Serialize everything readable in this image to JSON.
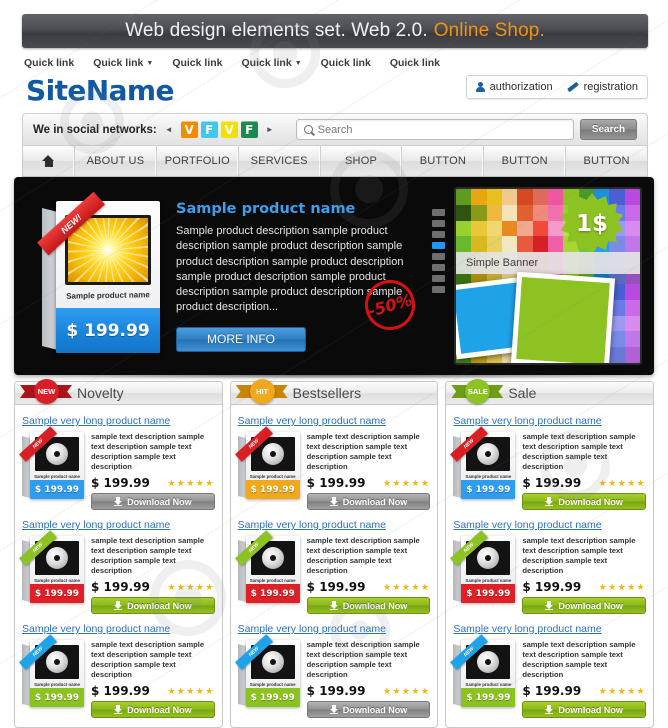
{
  "topbar": {
    "text_main": "Web design elements set. Web 2.0.",
    "text_accent": "Online Shop.",
    "accent_color": "#f2920d",
    "bg_color": "#4e4f55"
  },
  "quicklinks": [
    {
      "label": "Quick link",
      "has_dropdown": false
    },
    {
      "label": "Quick link",
      "has_dropdown": true
    },
    {
      "label": "Quick link",
      "has_dropdown": false
    },
    {
      "label": "Quick link",
      "has_dropdown": true
    },
    {
      "label": "Quick link",
      "has_dropdown": false
    },
    {
      "label": "Quick link",
      "has_dropdown": false
    }
  ],
  "brand": {
    "logo": "SiteName",
    "logo_color": "#1259a5"
  },
  "account": {
    "authorization": "authorization",
    "registration": "registration"
  },
  "social": {
    "label": "We in social networks:",
    "prev_arrow": "◄",
    "next_arrow": "►",
    "icons": [
      {
        "glyph": "V",
        "color": "#f28b00"
      },
      {
        "glyph": "F",
        "color": "#3fc8ee"
      },
      {
        "glyph": "V",
        "color": "#f2e000"
      },
      {
        "glyph": "F",
        "color": "#1b8a4b"
      }
    ]
  },
  "search": {
    "placeholder": "Search",
    "value": "",
    "button_label": "Search"
  },
  "nav": [
    {
      "label": "",
      "icon": "home-icon"
    },
    {
      "label": "ABOUT US",
      "icon": ""
    },
    {
      "label": "PORTFOLIO",
      "icon": ""
    },
    {
      "label": "SERVICES",
      "icon": ""
    },
    {
      "label": "SHOP",
      "icon": ""
    },
    {
      "label": "BUTTON",
      "icon": ""
    },
    {
      "label": "BUTTON",
      "icon": ""
    },
    {
      "label": "BUTTON",
      "icon": ""
    }
  ],
  "hero": {
    "title": "Sample product name",
    "description": "Sample product description sample product description sample product description sample product description sample product description sample product description sample product description sample product description sample product description...",
    "button_label": "MORE INFO",
    "discount_stamp": "-50%",
    "box": {
      "ribbon": "NEW!",
      "caption": "Sample product name",
      "price": "$ 199.99",
      "band_color": "#1a84dc"
    },
    "slider_dots": [
      {
        "active": false
      },
      {
        "active": false
      },
      {
        "active": false
      },
      {
        "active": true
      },
      {
        "active": false
      },
      {
        "active": false
      },
      {
        "active": false
      },
      {
        "active": false
      }
    ],
    "banner": {
      "badge_text": "1$",
      "label": "Simple Banner",
      "badge_color": "#8cc222",
      "frame1_color": "#1fa3e8",
      "frame2_color": "#8cc222"
    }
  },
  "columns": [
    {
      "title": "Novelty",
      "badge_text": "NEW",
      "badge_color": "#d81f26",
      "badge_dark": "#a8161c",
      "products": [
        {
          "name": "Sample very long product name",
          "description": "sample text description sample text description sample text description sample text description",
          "price": "$ 199.99",
          "rating": 5,
          "button_label": "Download Now",
          "button_style": "gray",
          "box_ribbon_color": "#d81f26",
          "box_band_color": "#2e9df0"
        },
        {
          "name": "Sample very long product name",
          "description": "sample text description sample text description sample text description sample text description",
          "price": "$ 199.99",
          "rating": 5,
          "button_label": "Download Now",
          "button_style": "green",
          "box_ribbon_color": "#8cc222",
          "box_band_color": "#e01f26"
        },
        {
          "name": "Sample very long product name",
          "description": "sample text description sample text description sample text description sample text description",
          "price": "$ 199.99",
          "rating": 5,
          "button_label": "Download Now",
          "button_style": "green",
          "box_ribbon_color": "#1fa3e8",
          "box_band_color": "#8cc222"
        }
      ]
    },
    {
      "title": "Bestsellers",
      "badge_text": "HIT",
      "badge_color": "#f0a81c",
      "badge_dark": "#c8850c",
      "products": [
        {
          "name": "Sample very long product name",
          "description": "sample text description sample text description sample text description sample text description",
          "price": "$ 199.99",
          "rating": 5,
          "button_label": "Download Now",
          "button_style": "gray",
          "box_ribbon_color": "#d81f26",
          "box_band_color": "#f0a81c"
        },
        {
          "name": "Sample very long product name",
          "description": "sample text description sample text description sample text description sample text description",
          "price": "$ 199.99",
          "rating": 5,
          "button_label": "Download Now",
          "button_style": "green",
          "box_ribbon_color": "#8cc222",
          "box_band_color": "#e01f26"
        },
        {
          "name": "Sample very long product name",
          "description": "sample text description sample text description sample text description sample text description",
          "price": "$ 199.99",
          "rating": 5,
          "button_label": "Download Now",
          "button_style": "gray",
          "box_ribbon_color": "#1fa3e8",
          "box_band_color": "#8cc222"
        }
      ]
    },
    {
      "title": "Sale",
      "badge_text": "SALE",
      "badge_color": "#8cc222",
      "badge_dark": "#6e9d18",
      "products": [
        {
          "name": "Sample very long product name",
          "description": "sample text description sample text description sample text description sample text description",
          "price": "$ 199.99",
          "rating": 5,
          "button_label": "Download Now",
          "button_style": "green",
          "box_ribbon_color": "#d81f26",
          "box_band_color": "#2e9df0"
        },
        {
          "name": "Sample very long product name",
          "description": "sample text description sample text description sample text description sample text description",
          "price": "$ 199.99",
          "rating": 5,
          "button_label": "Download Now",
          "button_style": "green",
          "box_ribbon_color": "#8cc222",
          "box_band_color": "#e01f26"
        },
        {
          "name": "Sample very long product name",
          "description": "sample text description sample text description sample text description sample text description",
          "price": "$ 199.99",
          "rating": 5,
          "button_label": "Download Now",
          "button_style": "green",
          "box_ribbon_color": "#1fa3e8",
          "box_band_color": "#8cc222"
        }
      ]
    }
  ]
}
